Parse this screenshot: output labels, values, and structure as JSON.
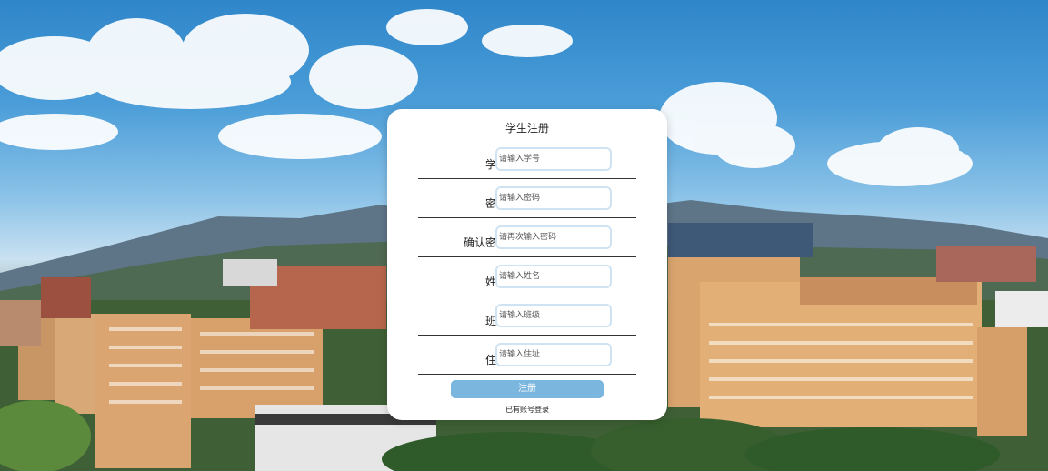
{
  "page": {
    "title": "学生注册"
  },
  "form": {
    "fields": [
      {
        "label": "学号:",
        "placeholder": "请输入学号"
      },
      {
        "label": "密码:",
        "placeholder": "请输入密码"
      },
      {
        "label": "确认密码:",
        "placeholder": "请再次输入密码"
      },
      {
        "label": "姓名:",
        "placeholder": "请输入姓名"
      },
      {
        "label": "班级:",
        "placeholder": "请输入班级"
      },
      {
        "label": "住址:",
        "placeholder": "请输入住址"
      }
    ],
    "submit_label": "注册",
    "login_link": "已有账号登录"
  },
  "colors": {
    "accent": "#7bb6df",
    "input_border": "#cfe3f2",
    "card_bg": "#ffffff"
  },
  "background": {
    "icon": "campus-photo"
  }
}
